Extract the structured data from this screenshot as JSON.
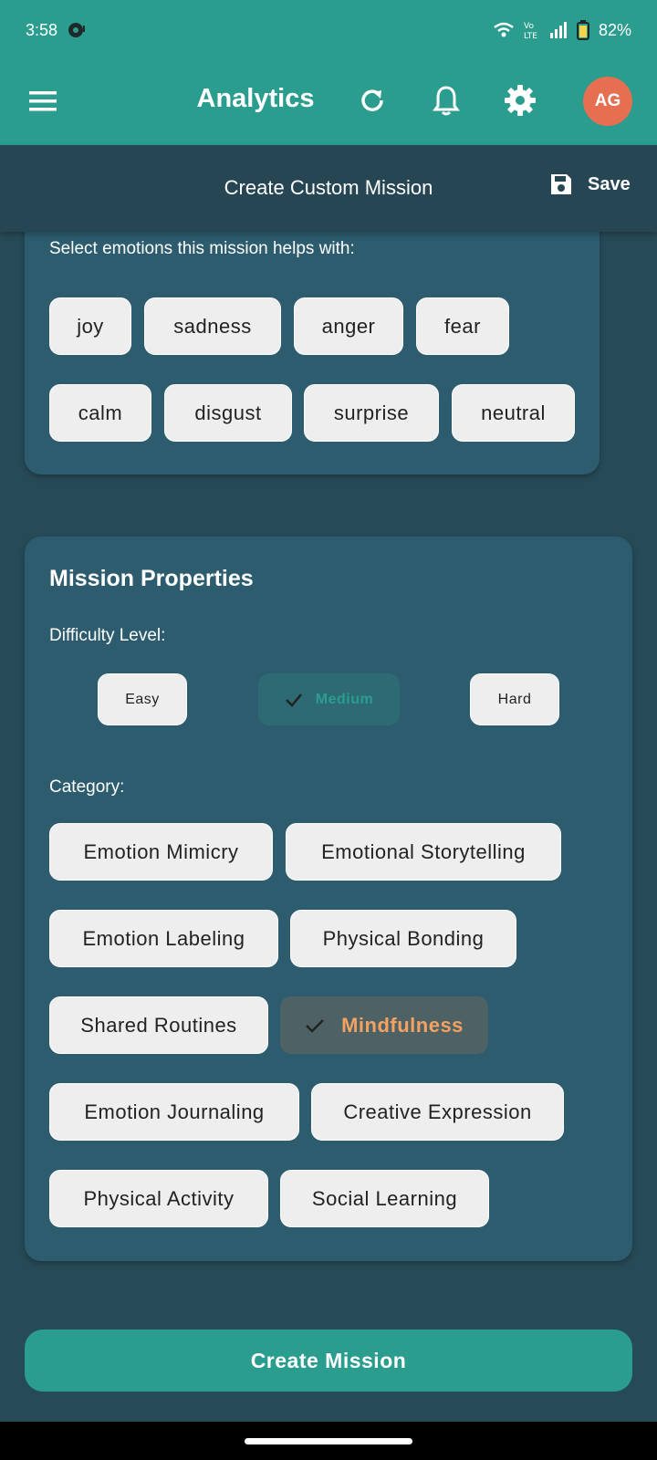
{
  "status_bar": {
    "time": "3:58",
    "battery": "82%"
  },
  "appbar": {
    "title": "Analytics",
    "avatar_initials": "AG"
  },
  "subheader": {
    "title": "Create Custom Mission",
    "save_label": "Save"
  },
  "emotions": {
    "prompt": "Select emotions this mission helps with:",
    "chips": [
      "joy",
      "sadness",
      "anger",
      "fear",
      "calm",
      "disgust",
      "surprise",
      "neutral"
    ]
  },
  "properties": {
    "heading": "Mission Properties",
    "difficulty_label": "Difficulty Level:",
    "difficulty_options": [
      "Easy",
      "Medium",
      "Hard"
    ],
    "difficulty_selected": "Medium",
    "category_label": "Category:",
    "categories": [
      "Emotion Mimicry",
      "Emotional Storytelling",
      "Emotion Labeling",
      "Physical Bonding",
      "Shared Routines",
      "Mindfulness",
      "Emotion Journaling",
      "Creative Expression",
      "Physical Activity",
      "Social Learning"
    ],
    "category_selected": "Mindfulness"
  },
  "create_button": "Create Mission",
  "colors": {
    "primary": "#2a9d8f",
    "accent": "#e76f51",
    "selected_text": "#f4a261",
    "card": "#2c5c6e",
    "background": "#274a57"
  }
}
